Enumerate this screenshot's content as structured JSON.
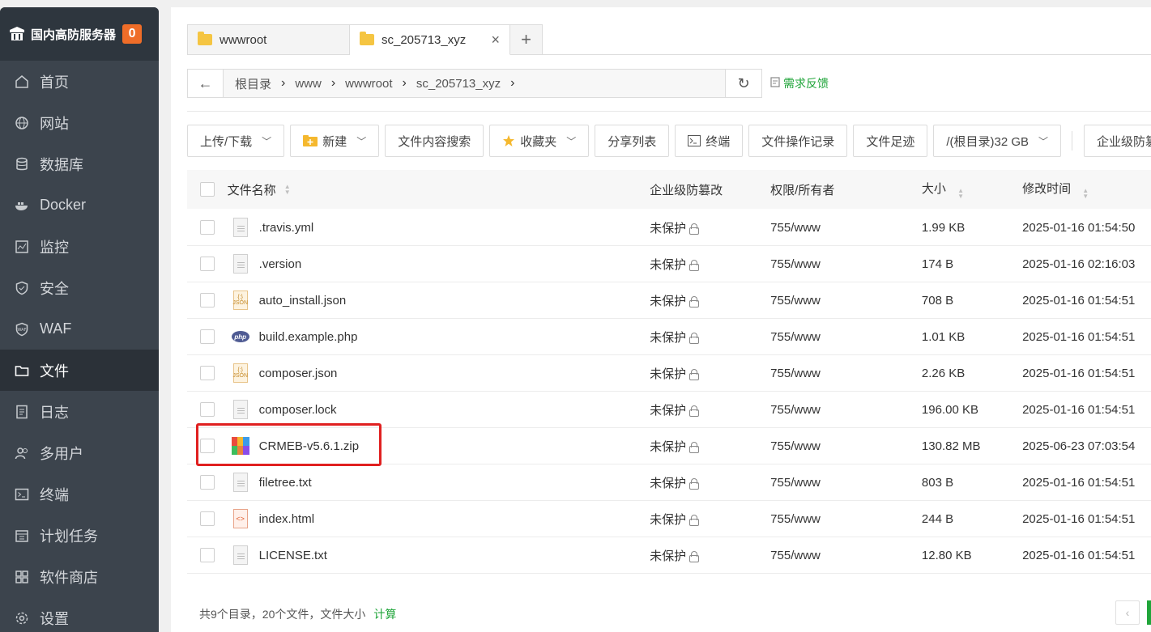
{
  "brand": {
    "title": "国内高防服务器",
    "badge": "0"
  },
  "nav": [
    {
      "label": "首页",
      "icon": "home-icon"
    },
    {
      "label": "网站",
      "icon": "globe-icon"
    },
    {
      "label": "数据库",
      "icon": "database-icon"
    },
    {
      "label": "Docker",
      "icon": "docker-icon"
    },
    {
      "label": "监控",
      "icon": "monitor-icon"
    },
    {
      "label": "安全",
      "icon": "shield-icon"
    },
    {
      "label": "WAF",
      "icon": "waf-icon"
    },
    {
      "label": "文件",
      "icon": "folder-icon",
      "active": true
    },
    {
      "label": "日志",
      "icon": "log-icon"
    },
    {
      "label": "多用户",
      "icon": "users-icon"
    },
    {
      "label": "终端",
      "icon": "terminal-icon"
    },
    {
      "label": "计划任务",
      "icon": "calendar-icon"
    },
    {
      "label": "软件商店",
      "icon": "grid-icon"
    },
    {
      "label": "设置",
      "icon": "gear-icon"
    }
  ],
  "tabs": [
    {
      "label": "wwwroot"
    },
    {
      "label": "sc_205713_xyz",
      "close": "×"
    }
  ],
  "add_tab": "+",
  "path": {
    "back": "←",
    "crumbs": [
      "根目录",
      "www",
      "wwwroot",
      "sc_205713_xyz"
    ],
    "sep": "›",
    "refresh": "↻"
  },
  "feedback": "需求反馈",
  "toolbar": {
    "upload": "上传/下载",
    "new": "新建",
    "search": "文件内容搜索",
    "favorites": "收藏夹",
    "share": "分享列表",
    "terminal": "终端",
    "oplog": "文件操作记录",
    "trace": "文件足迹",
    "disk": "/(根目录)32 GB",
    "tamper": "企业级防篡"
  },
  "columns": {
    "name": "文件名称",
    "tamper": "企业级防篡改",
    "perm": "权限/所有者",
    "size": "大小",
    "time": "修改时间"
  },
  "files": [
    {
      "name": ".travis.yml",
      "type": "doc",
      "tamper": "未保护",
      "perm": "755/www",
      "size": "1.99 KB",
      "time": "2025-01-16 01:54:50"
    },
    {
      "name": ".version",
      "type": "doc",
      "tamper": "未保护",
      "perm": "755/www",
      "size": "174 B",
      "time": "2025-01-16 02:16:03"
    },
    {
      "name": "auto_install.json",
      "type": "json",
      "tamper": "未保护",
      "perm": "755/www",
      "size": "708 B",
      "time": "2025-01-16 01:54:51"
    },
    {
      "name": "build.example.php",
      "type": "php",
      "tamper": "未保护",
      "perm": "755/www",
      "size": "1.01 KB",
      "time": "2025-01-16 01:54:51"
    },
    {
      "name": "composer.json",
      "type": "json",
      "tamper": "未保护",
      "perm": "755/www",
      "size": "2.26 KB",
      "time": "2025-01-16 01:54:51"
    },
    {
      "name": "composer.lock",
      "type": "doc",
      "tamper": "未保护",
      "perm": "755/www",
      "size": "196.00 KB",
      "time": "2025-01-16 01:54:51"
    },
    {
      "name": "CRMEB-v5.6.1.zip",
      "type": "zip",
      "tamper": "未保护",
      "perm": "755/www",
      "size": "130.82 MB",
      "time": "2025-06-23 07:03:54"
    },
    {
      "name": "filetree.txt",
      "type": "doc",
      "tamper": "未保护",
      "perm": "755/www",
      "size": "803 B",
      "time": "2025-01-16 01:54:51"
    },
    {
      "name": "index.html",
      "type": "html",
      "tamper": "未保护",
      "perm": "755/www",
      "size": "244 B",
      "time": "2025-01-16 01:54:51"
    },
    {
      "name": "LICENSE.txt",
      "type": "doc",
      "tamper": "未保护",
      "perm": "755/www",
      "size": "12.80 KB",
      "time": "2025-01-16 01:54:51"
    }
  ],
  "footer": {
    "summary": "共9个目录，20个文件，文件大小",
    "calc": "计算"
  },
  "colors": {
    "accent": "#20a53a",
    "sidebar": "#3c444d",
    "highlight": "#e02020",
    "badge": "#ef6d28"
  }
}
